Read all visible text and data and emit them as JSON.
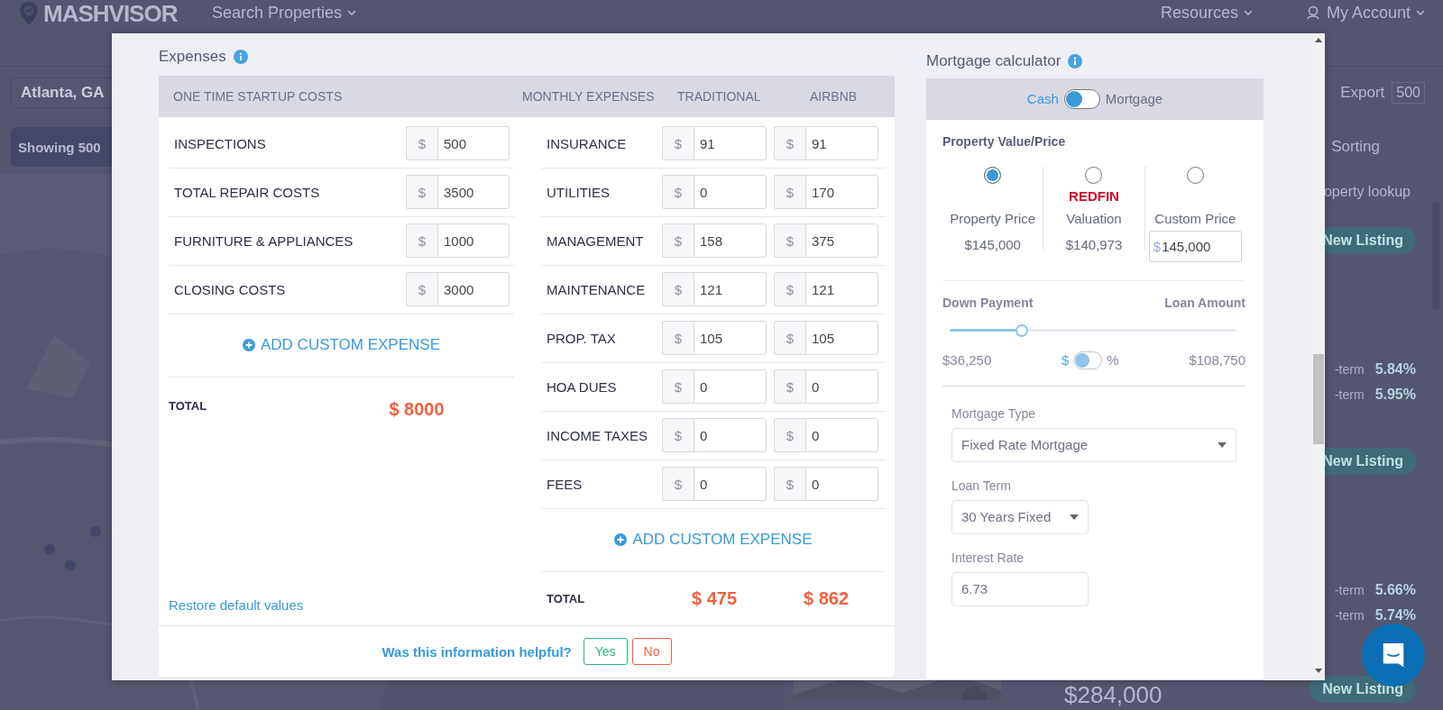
{
  "background": {
    "logo": "MASHVISOR",
    "nav": [
      {
        "label": "Search Properties"
      },
      {
        "label": "Resources"
      },
      {
        "label": "My Account"
      }
    ],
    "location_field": {
      "value": "Atlanta, GA"
    },
    "export": {
      "label": "Export",
      "count": "500"
    },
    "showing_button": "Showing 500",
    "sorting": "Sorting",
    "lookup": "operty lookup",
    "listings": [
      {
        "badge": "New Listing",
        "rates": [
          {
            "label": "-term",
            "value": "5.84%"
          },
          {
            "label": "-term",
            "value": "5.95%"
          }
        ]
      },
      {
        "badge": "New Listing",
        "rates": [
          {
            "label": "-term",
            "value": "5.66%"
          },
          {
            "label": "-term",
            "value": "5.74%"
          }
        ]
      },
      {
        "price": "$284,000",
        "badge": "New Listing"
      }
    ]
  },
  "expenses": {
    "title": "Expenses",
    "headings": [
      "ONE TIME STARTUP COSTS",
      "MONTHLY EXPENSES",
      "TRADITIONAL",
      "AIRBNB"
    ],
    "one_time": {
      "rows": [
        {
          "label": "INSPECTIONS",
          "prefix": "$",
          "value": "500"
        },
        {
          "label": "TOTAL REPAIR COSTS",
          "prefix": "$",
          "value": "3500"
        },
        {
          "label": "FURNITURE & APPLIANCES",
          "prefix": "$",
          "value": "1000"
        },
        {
          "label": "CLOSING COSTS",
          "prefix": "$",
          "value": "3000"
        }
      ],
      "add_button": "ADD CUSTOM EXPENSE",
      "total_label": "TOTAL",
      "total": "$ 8000",
      "restore_link": "Restore default values"
    },
    "monthly": {
      "rows": [
        {
          "label": "INSURANCE",
          "traditional": {
            "prefix": "$",
            "value": "91"
          },
          "airbnb": {
            "prefix": "$",
            "value": "91"
          }
        },
        {
          "label": "UTILITIES",
          "traditional": {
            "prefix": "$",
            "value": "0"
          },
          "airbnb": {
            "prefix": "$",
            "value": "170"
          }
        },
        {
          "label": "MANAGEMENT",
          "traditional": {
            "prefix": "$",
            "value": "158"
          },
          "airbnb": {
            "prefix": "$",
            "value": "375"
          }
        },
        {
          "label": "MAINTENANCE",
          "traditional": {
            "prefix": "$",
            "value": "121"
          },
          "airbnb": {
            "prefix": "$",
            "value": "121"
          }
        },
        {
          "label": "PROP. TAX",
          "traditional": {
            "prefix": "$",
            "value": "105"
          },
          "airbnb": {
            "prefix": "$",
            "value": "105"
          }
        },
        {
          "label": "HOA DUES",
          "traditional": {
            "prefix": "$",
            "value": "0"
          },
          "airbnb": {
            "prefix": "$",
            "value": "0"
          }
        },
        {
          "label": "INCOME TAXES",
          "traditional": {
            "prefix": "$",
            "value": "0"
          },
          "airbnb": {
            "prefix": "$",
            "value": "0"
          }
        },
        {
          "label": "FEES",
          "traditional": {
            "prefix": "$",
            "value": "0"
          },
          "airbnb": {
            "prefix": "$",
            "value": "0"
          }
        }
      ],
      "add_button": "ADD CUSTOM EXPENSE",
      "total_label": "TOTAL",
      "totals": [
        "$ 475",
        "$ 862"
      ]
    },
    "feedback": {
      "question": "Was this information helpful?",
      "buttons": [
        {
          "label": "Yes",
          "kind": "positive"
        },
        {
          "label": "No",
          "kind": "negative"
        }
      ]
    }
  },
  "mortgage_calculator": {
    "title": "Mortgage calculator",
    "mode_toggle": {
      "left": "Cash",
      "right": "Mortgage",
      "on": false
    },
    "property_value": {
      "title": "Property Value/Price",
      "options": [
        {
          "kind": "fixed",
          "label": "Property Price",
          "value": "$145,000",
          "selected": true
        },
        {
          "kind": "fixed",
          "brand": "REDFIN",
          "label": "Valuation",
          "value": "$140,973",
          "selected": false
        },
        {
          "kind": "input",
          "label": "Custom Price",
          "prefix": "$",
          "value": "145,000",
          "selected": false
        }
      ]
    },
    "financing": {
      "disabled": true,
      "down_payment": {
        "label": "Down Payment",
        "loan_label": "Loan Amount",
        "level": 0.25,
        "amount": "$36,250",
        "unit_left": "$",
        "unit_right": "%",
        "unit_toggle_on": false,
        "loan_amount": "$108,750"
      },
      "mortgage_type": {
        "label": "Mortgage Type",
        "value": "Fixed Rate Mortgage"
      },
      "loan_term": {
        "label": "Loan Term",
        "value": "30 Years Fixed"
      },
      "interest_rate": {
        "label": "Interest Rate",
        "value": "6.73"
      }
    }
  }
}
